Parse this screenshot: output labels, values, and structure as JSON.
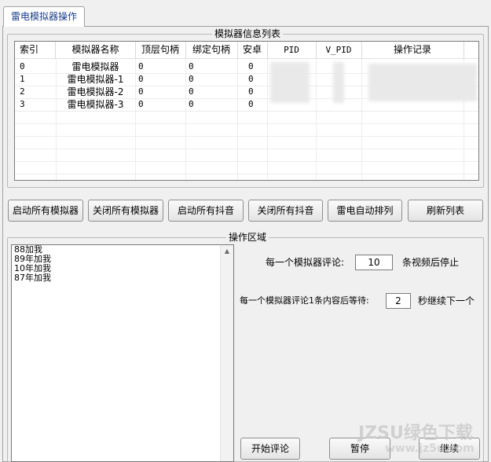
{
  "tab": {
    "label": "雷电模拟器操作"
  },
  "list_group": {
    "title": "模拟器信息列表",
    "columns": [
      "索引",
      "模拟器名称",
      "顶层句柄",
      "绑定句柄",
      "安卓",
      "PID",
      "V_PID",
      "操作记录"
    ],
    "rows": [
      {
        "index": "0",
        "name": "雷电模拟器",
        "top": "0",
        "bind": "0",
        "android": "0"
      },
      {
        "index": "1",
        "name": "雷电模拟器-1",
        "top": "0",
        "bind": "0",
        "android": "0"
      },
      {
        "index": "2",
        "name": "雷电模拟器-2",
        "top": "0",
        "bind": "0",
        "android": "0"
      },
      {
        "index": "3",
        "name": "雷电模拟器-3",
        "top": "0",
        "bind": "0",
        "android": "0"
      }
    ]
  },
  "buttons": {
    "start_all_emulators": "启动所有模拟器",
    "close_all_emulators": "关闭所有模拟器",
    "start_all_douyin": "启动所有抖音",
    "close_all_douyin": "关闭所有抖音",
    "auto_arrange": "雷电自动排列",
    "refresh_list": "刷新列表"
  },
  "operation_group": {
    "title": "操作区域",
    "comments": [
      "88加我",
      "89年加我",
      "10年加我",
      "87年加我"
    ],
    "comment_count_prefix": "每一个模拟器评论:",
    "comment_count_value": "10",
    "comment_count_suffix": "条视频后停止",
    "wait_prefix": "每一个模拟器评论1条内容后等待:",
    "wait_value": "2",
    "wait_suffix": "秒继续下一个",
    "start_comment": "开始评论",
    "pause": "暂停",
    "resume": "继续"
  },
  "watermark": {
    "line1": "JZSU绿色下载",
    "line2": "www.jz5u.com"
  }
}
